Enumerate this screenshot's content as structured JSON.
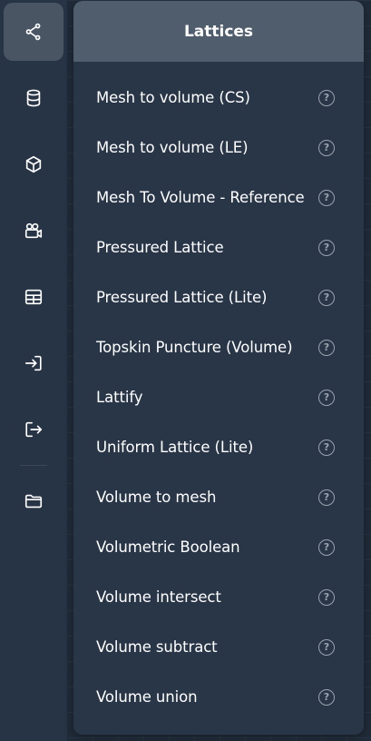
{
  "rail": {
    "icons": [
      "share-nodes-icon",
      "database-icon",
      "cube-icon",
      "video-camera-icon",
      "table-icon",
      "login-icon",
      "logout-icon",
      "folder-icon"
    ]
  },
  "panel": {
    "title": "Lattices",
    "help_glyph": "?",
    "items": [
      {
        "label": "Mesh to volume (CS)"
      },
      {
        "label": "Mesh to volume (LE)"
      },
      {
        "label": "Mesh To Volume - Reference"
      },
      {
        "label": "Pressured Lattice"
      },
      {
        "label": "Pressured Lattice (Lite)"
      },
      {
        "label": "Topskin Puncture (Volume)"
      },
      {
        "label": "Lattify"
      },
      {
        "label": "Uniform Lattice (Lite)"
      },
      {
        "label": "Volume to mesh"
      },
      {
        "label": "Volumetric Boolean"
      },
      {
        "label": "Volume intersect"
      },
      {
        "label": "Volume subtract"
      },
      {
        "label": "Volume union"
      }
    ]
  },
  "colors": {
    "background": "#1f2a38",
    "rail": "#273445",
    "panel": "#293648",
    "header": "#505d6d",
    "active_rail": "#4a5564",
    "help_icon": "#9aa3ae"
  }
}
